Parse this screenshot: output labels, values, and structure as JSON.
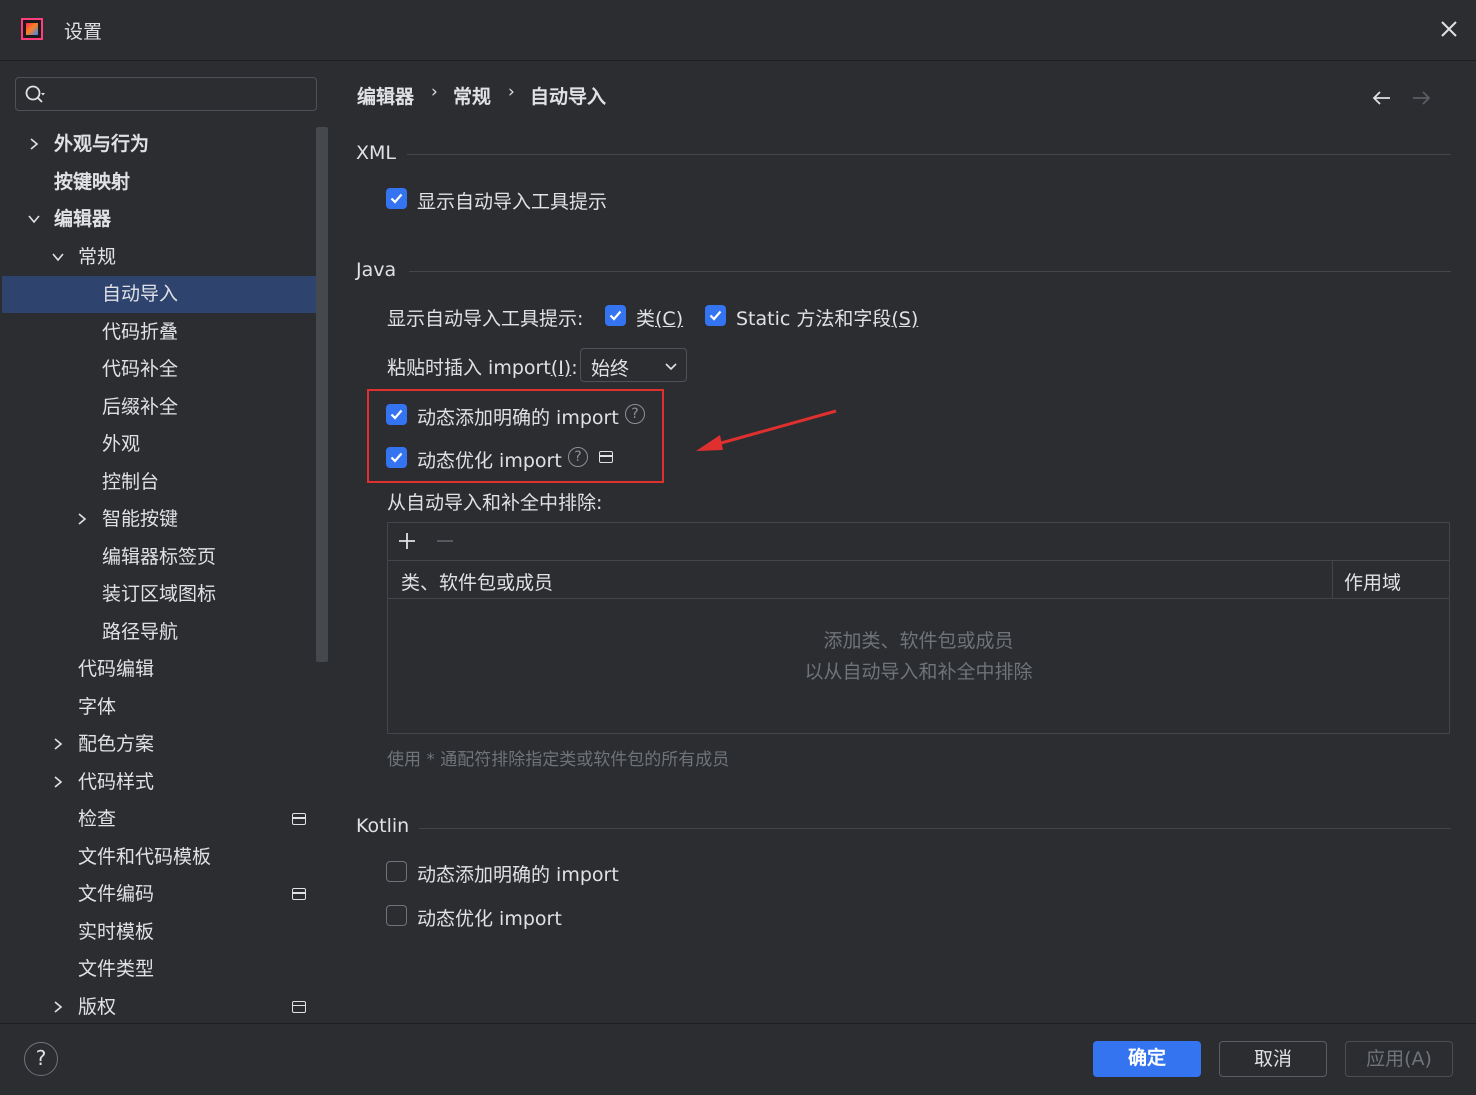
{
  "window": {
    "title": "设置"
  },
  "search": {
    "placeholder": ""
  },
  "sidebar": {
    "items": [
      {
        "label": "外观与行为",
        "chev": "right",
        "bold": true
      },
      {
        "label": "按键映射",
        "chev": "",
        "bold": true
      },
      {
        "label": "编辑器",
        "chev": "down",
        "bold": true
      },
      {
        "label": "常规",
        "chev": "down"
      },
      {
        "label": "自动导入",
        "selected": true
      },
      {
        "label": "代码折叠"
      },
      {
        "label": "代码补全"
      },
      {
        "label": "后缀补全"
      },
      {
        "label": "外观"
      },
      {
        "label": "控制台"
      },
      {
        "label": "智能按键",
        "chev": "right"
      },
      {
        "label": "编辑器标签页"
      },
      {
        "label": "装订区域图标"
      },
      {
        "label": "路径导航"
      },
      {
        "label": "代码编辑"
      },
      {
        "label": "字体"
      },
      {
        "label": "配色方案",
        "chev": "right"
      },
      {
        "label": "代码样式",
        "chev": "right"
      },
      {
        "label": "检查",
        "badge": true
      },
      {
        "label": "文件和代码模板"
      },
      {
        "label": "文件编码",
        "badge": true
      },
      {
        "label": "实时模板"
      },
      {
        "label": "文件类型"
      },
      {
        "label": "版权",
        "chev": "right",
        "badge": true
      }
    ]
  },
  "breadcrumb": {
    "items": [
      "编辑器",
      "常规",
      "自动导入"
    ],
    "separator": "›"
  },
  "xml": {
    "title": "XML",
    "show_tooltip_label": "显示自动导入工具提示",
    "show_tooltip_checked": true
  },
  "java": {
    "title": "Java",
    "show_tooltip_prefix": "显示自动导入工具提示:",
    "class_label": "类",
    "class_mnemonic": "(C)",
    "class_checked": true,
    "static_label": "Static 方法和字段",
    "static_mnemonic": "(S)",
    "static_checked": true,
    "paste_label_prefix": "粘贴时插入 import",
    "paste_mnemonic": "(I)",
    "paste_label_suffix": ":",
    "paste_value": "始终",
    "add_unambiguous_label": "动态添加明确的 import",
    "add_unambiguous_checked": true,
    "optimize_label": "动态优化 import",
    "optimize_checked": true,
    "exclude_label": "从自动导入和补全中排除:",
    "table": {
      "columns": [
        "类、软件包或成员",
        "作用域"
      ],
      "empty_line1": "添加类、软件包或成员",
      "empty_line2": "以从自动导入和补全中排除"
    },
    "wildcard_hint": "使用 * 通配符排除指定类或软件包的所有成员"
  },
  "kotlin": {
    "title": "Kotlin",
    "add_unambiguous_label": "动态添加明确的 import",
    "add_unambiguous_checked": false,
    "optimize_label": "动态优化 import",
    "optimize_checked": false
  },
  "footer": {
    "help": "?",
    "ok": "确定",
    "cancel": "取消",
    "apply": "应用(A)"
  },
  "colors": {
    "accent": "#3574f0",
    "background": "#2b2d30",
    "selection": "#2e436e",
    "annotation": "#e02f2f"
  }
}
